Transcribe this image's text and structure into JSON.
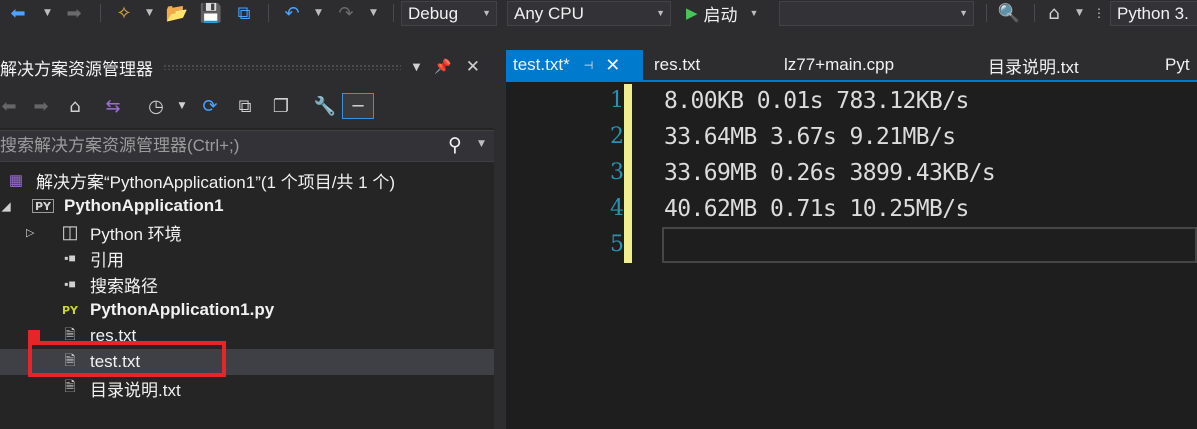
{
  "toolbar": {
    "config_value": "Debug",
    "platform_value": "Any CPU",
    "run_label": "启动",
    "startup_item": "",
    "env_value": "Python 3."
  },
  "solution_explorer": {
    "title": "解决方案资源管理器",
    "search_placeholder": "搜索解决方案资源管理器(Ctrl+;)",
    "tree": [
      {
        "label": "解决方案“PythonApplication1”(1 个项目/共 1 个)",
        "icon": "solution-icon"
      },
      {
        "label": "PythonApplication1",
        "icon": "python-project-icon",
        "bold": true,
        "expanded": true
      },
      {
        "label": "Python 环境",
        "icon": "environment-icon",
        "collapsed": true
      },
      {
        "label": "引用",
        "icon": "references-icon"
      },
      {
        "label": "搜索路径",
        "icon": "search-paths-icon"
      },
      {
        "label": "PythonApplication1.py",
        "icon": "python-file-icon",
        "bold": true
      },
      {
        "label": "res.txt",
        "icon": "text-file-icon"
      },
      {
        "label": "test.txt",
        "icon": "text-file-icon",
        "selected": true
      },
      {
        "label": "目录说明.txt",
        "icon": "text-file-icon"
      }
    ]
  },
  "tabs": [
    {
      "label": "test.txt*",
      "active": true
    },
    {
      "label": "res.txt"
    },
    {
      "label": "lz77+main.cpp"
    },
    {
      "label": "目录说明.txt"
    },
    {
      "label": "Pyt"
    }
  ],
  "editor": {
    "line_numbers": [
      "1",
      "2",
      "3",
      "4",
      "5"
    ],
    "lines": [
      "8.00KB 0.01s 783.12KB/s",
      "33.64MB 3.67s 9.21MB/s",
      "33.69MB 0.26s 3899.43KB/s",
      "40.62MB 0.71s 10.25MB/s",
      ""
    ]
  },
  "colors": {
    "accent": "#007acc",
    "highlight_box": "#e6252b",
    "line_number": "#2b91af",
    "change_marker": "#efef8e"
  }
}
